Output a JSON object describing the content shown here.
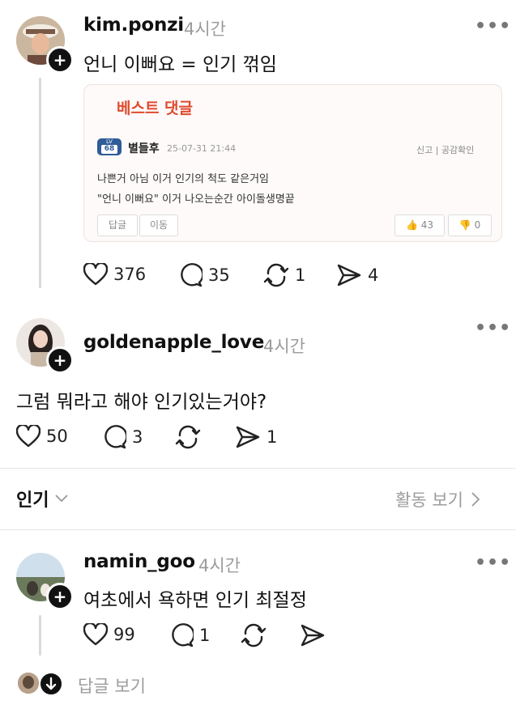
{
  "posts": [
    {
      "username": "kim.ponzi",
      "time": "4시간",
      "text": "언니 이뻐요 = 인기 꺾임",
      "likes": "376",
      "comments": "35",
      "reposts": "1",
      "shares": "4"
    },
    {
      "username": "goldenapple_love",
      "time": "4시간",
      "text": "그럼 뭐라고 해야 인기있는거야?",
      "likes": "50",
      "comments": "3",
      "reposts": "",
      "shares": "1"
    },
    {
      "username": "namin_goo",
      "time": "4시간",
      "text": "여초에서 욕하면 인기 최절정",
      "likes": "99",
      "comments": "1",
      "reposts": "",
      "shares": ""
    }
  ],
  "more_icon": "•••",
  "embedded": {
    "title": "베스트 댓글",
    "author": "별들후",
    "date": "25-07-31 21:44",
    "actions": "신고 | 공감확인",
    "line1": "나쁜거 아님 이거 인기의 척도 같은거임",
    "line2": "\"언니 이뻐요\" 이거 나오는순간 아이돌생명끝",
    "reply_btn": "답글",
    "move_btn": "이동",
    "up_count": "43",
    "down_count": "0",
    "badge_top": "LV",
    "badge_num": "68"
  },
  "sort": {
    "label": "인기",
    "activity": "활동 보기"
  },
  "view_replies": "답글 보기",
  "colors": {
    "accent": "#e04a2f",
    "muted": "#9c9c9c",
    "line": "#dadada"
  }
}
